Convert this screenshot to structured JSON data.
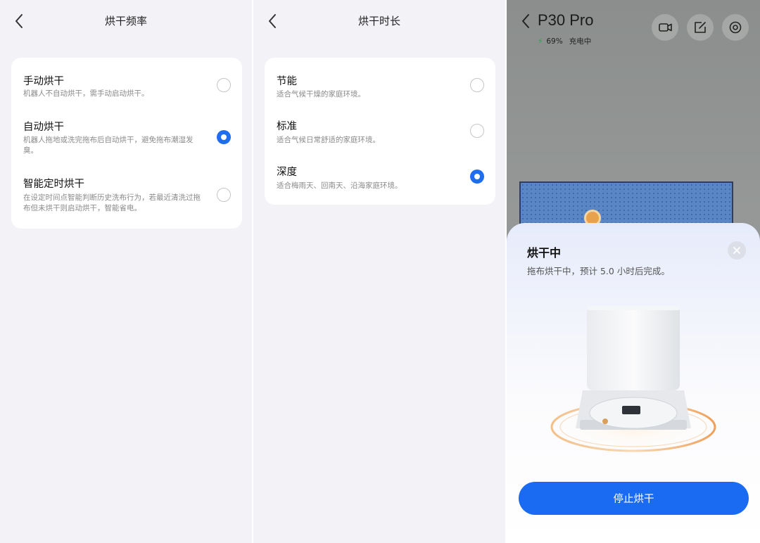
{
  "panel_frequency": {
    "title": "烘干频率",
    "options": [
      {
        "title": "手动烘干",
        "desc": "机器人不自动烘干，需手动启动烘干。",
        "selected": false
      },
      {
        "title": "自动烘干",
        "desc": "机器人拖地或洗完拖布后自动烘干，避免拖布潮湿发臭。",
        "selected": true
      },
      {
        "title": "智能定时烘干",
        "desc": "在设定时间点智能判断历史洗布行为，若最近清洗过拖布但未烘干则启动烘干，智能省电。",
        "selected": false
      }
    ]
  },
  "panel_duration": {
    "title": "烘干时长",
    "options": [
      {
        "title": "节能",
        "desc": "适合气候干燥的家庭环境。",
        "selected": false
      },
      {
        "title": "标准",
        "desc": "适合气候日常舒适的家庭环境。",
        "selected": false
      },
      {
        "title": "深度",
        "desc": "适合梅雨天、回南天、沿海家庭环境。",
        "selected": true
      }
    ]
  },
  "device": {
    "name": "P30 Pro",
    "battery": "69%",
    "status": "充电中",
    "sheet": {
      "title": "烘干中",
      "desc": "拖布烘干中，预计 5.0 小时后完成。",
      "stop_label": "停止烘干"
    }
  },
  "colors": {
    "accent": "#1a6bf2",
    "background": "#f2f2f7"
  },
  "icons": [
    "chevron-left-icon",
    "video-icon",
    "edit-icon",
    "settings-icon",
    "close-icon",
    "bolt-icon"
  ]
}
